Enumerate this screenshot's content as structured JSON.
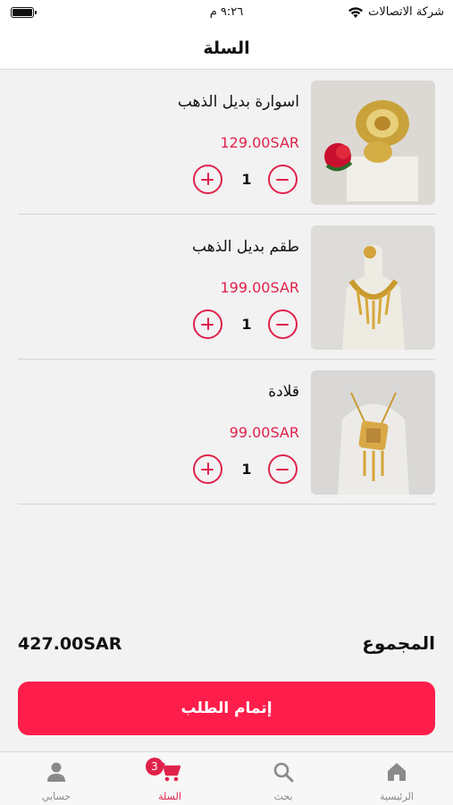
{
  "status_bar": {
    "carrier": "شركة الاتصالات",
    "time": "٩:٢٦ م"
  },
  "header": {
    "title": "السلة"
  },
  "cart": {
    "items": [
      {
        "name": "اسوارة بديل الذهب",
        "price": "129.00SAR",
        "quantity": "1",
        "image": "gold-bracelet-photo"
      },
      {
        "name": "طقم بديل الذهب",
        "price": "199.00SAR",
        "quantity": "1",
        "image": "gold-necklace-set-photo"
      },
      {
        "name": "قلادة",
        "price": "99.00SAR",
        "quantity": "1",
        "image": "gold-pendant-necklace-photo"
      }
    ]
  },
  "summary": {
    "total_label": "المجموع",
    "total_value": "427.00SAR"
  },
  "checkout": {
    "label": "إتمام الطلب"
  },
  "tab_bar": {
    "tabs": [
      {
        "label": "الرئيسية",
        "icon": "home-icon"
      },
      {
        "label": "بحث",
        "icon": "search-icon"
      },
      {
        "label": "السلة",
        "icon": "cart-icon",
        "badge": "3",
        "active": true
      },
      {
        "label": "حسابي",
        "icon": "user-icon"
      }
    ]
  },
  "colors": {
    "accent": "#e0224b",
    "button": "#ff1e4b"
  }
}
